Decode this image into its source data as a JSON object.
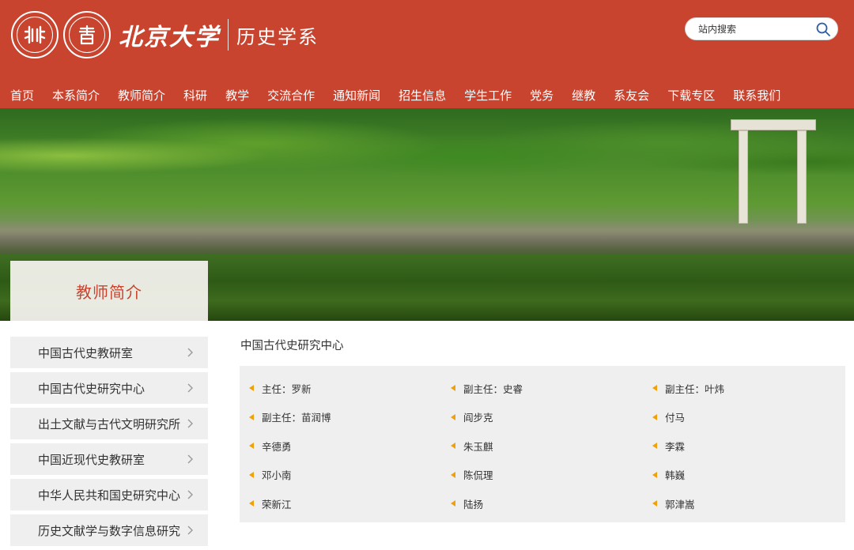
{
  "header": {
    "university_name": "北京大学",
    "department_name": "历史学系",
    "search_placeholder": "站内搜索",
    "brand_color": "#c9442f"
  },
  "nav": {
    "items": [
      "首页",
      "本系简介",
      "教师简介",
      "科研",
      "教学",
      "交流合作",
      "通知新闻",
      "招生信息",
      "学生工作",
      "党务",
      "继教",
      "系友会",
      "下载专区",
      "联系我们"
    ]
  },
  "banner": {
    "section_title": "教师简介"
  },
  "sidebar": {
    "items": [
      {
        "label": "中国古代史教研室"
      },
      {
        "label": "中国古代史研究中心"
      },
      {
        "label": "出土文献与古代文明研究所"
      },
      {
        "label": "中国近现代史教研室"
      },
      {
        "label": "中华人民共和国史研究中心"
      },
      {
        "label": "历史文献学与数字信息研究"
      }
    ]
  },
  "main": {
    "title": "中国古代史研究中心",
    "staff": [
      "主任：罗新",
      "副主任：史睿",
      "副主任：叶炜",
      "副主任：苗润博",
      "阎步克",
      "付马",
      "辛德勇",
      "朱玉麒",
      "李霖",
      "邓小南",
      "陈侃理",
      "韩巍",
      "荣新江",
      "陆扬",
      "郭津嵩"
    ],
    "bullet_color": "#f0a10a"
  }
}
